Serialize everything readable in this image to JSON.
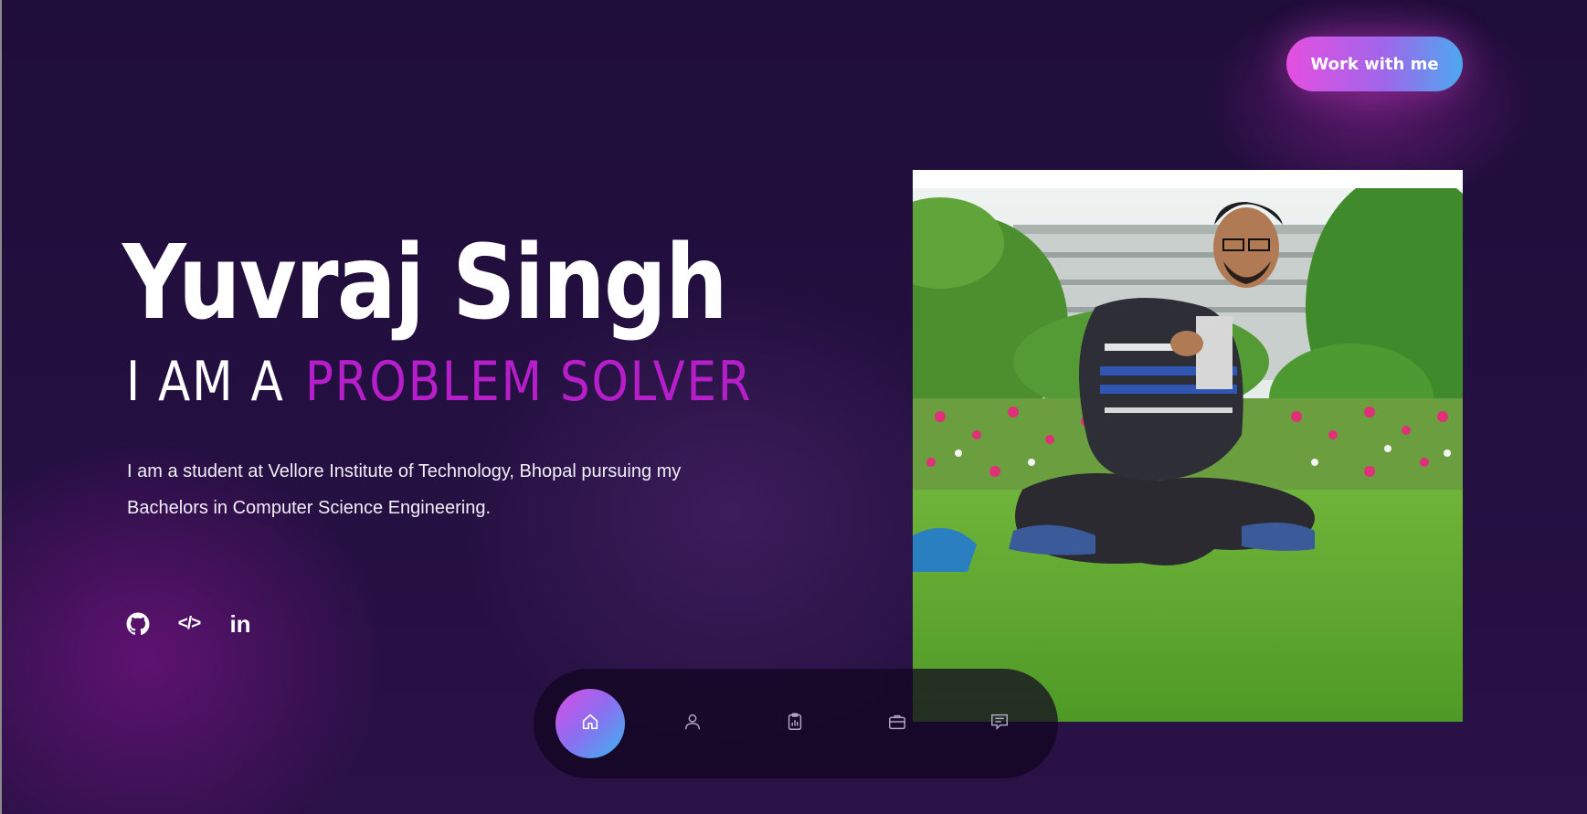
{
  "header": {
    "cta_label": "Work with me"
  },
  "hero": {
    "name": "Yuvraj Singh",
    "tagline_prefix": "I AM A",
    "tagline_highlight": "PROBLEM SOLVER",
    "intro": "I am a student at Vellore Institute of Technology, Bhopal pursuing my Bachelors in Computer Science Engineering."
  },
  "socials": [
    {
      "icon": "github-icon"
    },
    {
      "icon": "code-icon",
      "text": "</>"
    },
    {
      "icon": "linkedin-icon",
      "text": "in"
    }
  ],
  "photo": {
    "alt": "Portrait photo"
  },
  "nav": {
    "active": "home",
    "items": [
      {
        "id": "home",
        "icon": "home-icon"
      },
      {
        "id": "about",
        "icon": "user-icon"
      },
      {
        "id": "skills",
        "icon": "clipboard-chart-icon"
      },
      {
        "id": "projects",
        "icon": "briefcase-icon"
      },
      {
        "id": "contact",
        "icon": "message-icon"
      }
    ]
  },
  "colors": {
    "background": "#22103d",
    "accent_pink": "#e54fe0",
    "accent_blue": "#4da8ee",
    "highlight_text": "#b51ec8"
  }
}
